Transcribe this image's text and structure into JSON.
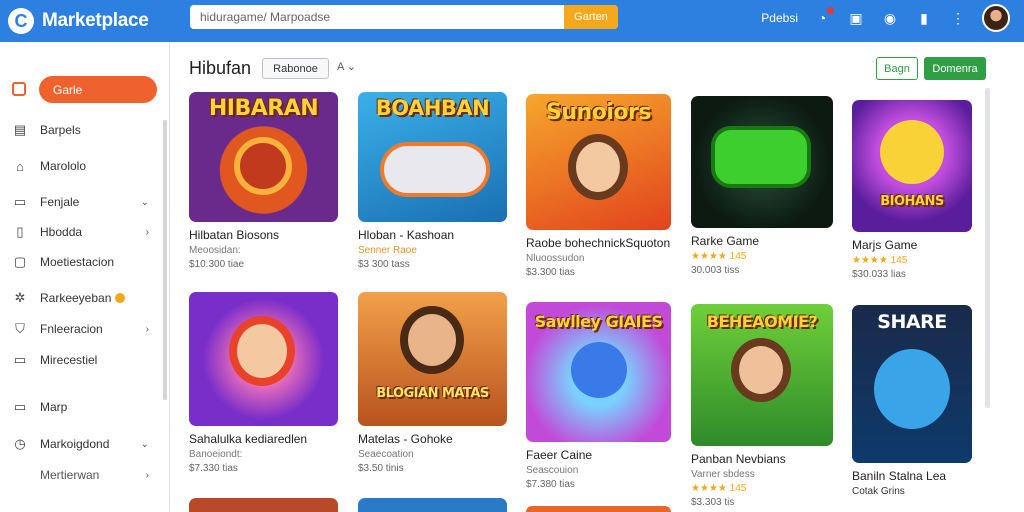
{
  "app": {
    "name": "Marketplace"
  },
  "search": {
    "placeholder": "hiduragame/ Marpoadse",
    "button": "Garten"
  },
  "topbar": {
    "link": "Pdebsi"
  },
  "sidebar": {
    "active": "Garle",
    "items": [
      {
        "label": "Barpels"
      },
      {
        "label": "Marololo"
      },
      {
        "label": "Fenjale"
      },
      {
        "label": "Hbodda"
      },
      {
        "label": "Moetiestacion"
      },
      {
        "label": "Rarkeeyeban"
      },
      {
        "label": "Fnleeracion"
      },
      {
        "label": "Mirecestiel"
      },
      {
        "label": "Marp"
      },
      {
        "label": "Markoigdond"
      },
      {
        "label": "Mertierwan"
      }
    ]
  },
  "main": {
    "title": "Hibufan",
    "filter": "Rabonoe",
    "sort": "A",
    "btn_outline": "Bagn",
    "btn_solid": "Domenra"
  },
  "cards": [
    {
      "art": "HIBARAN",
      "title": "Hilbatan Biosons",
      "sub": "Meoosidan:",
      "rating": "",
      "price": "$10.300 tiae"
    },
    {
      "art": "BOAHBAN",
      "title": "Hloban - Kashoan",
      "sub": "Senner Raoe",
      "rating": "",
      "price": "$3 300 tass"
    },
    {
      "art": "Sunoiors",
      "title": "Raobe bohechnickSquoton",
      "sub": "Nluoossudon",
      "rating": "",
      "price": "$3.300 tias"
    },
    {
      "art": "",
      "title": "Rarke Game",
      "sub": "",
      "rating": "★★★★ 145",
      "price": "30.003 tiss"
    },
    {
      "art": "BIOHANS",
      "title": "Marjs Game",
      "sub": "",
      "rating": "★★★★ 145",
      "price": "$30.033 lias"
    },
    {
      "art": "",
      "title": "Sahalulka kediaredlen",
      "sub": "Banoeiondt:",
      "rating": "",
      "price": "$7.330 tias"
    },
    {
      "art": "BLOGIAN MATAS",
      "title": "Matelas - Gohoke",
      "sub": "Seaecoation",
      "rating": "",
      "price": "$3.50 tinis"
    },
    {
      "art": "Sawlley GIAIES",
      "title": "Faeer Caine",
      "sub": "Seascouion",
      "rating": "",
      "price": "$7.380 tias"
    },
    {
      "art": "BEHEAOMIE?",
      "title": "Panban Nevbians",
      "sub": "Varner sbdess",
      "rating": "★★★★ 145",
      "price": "$3.303 tis"
    },
    {
      "art": "SHARE",
      "title": "Baniln Stalna Lea",
      "sub": "Cotak Grins",
      "rating": "",
      "price": ""
    }
  ]
}
